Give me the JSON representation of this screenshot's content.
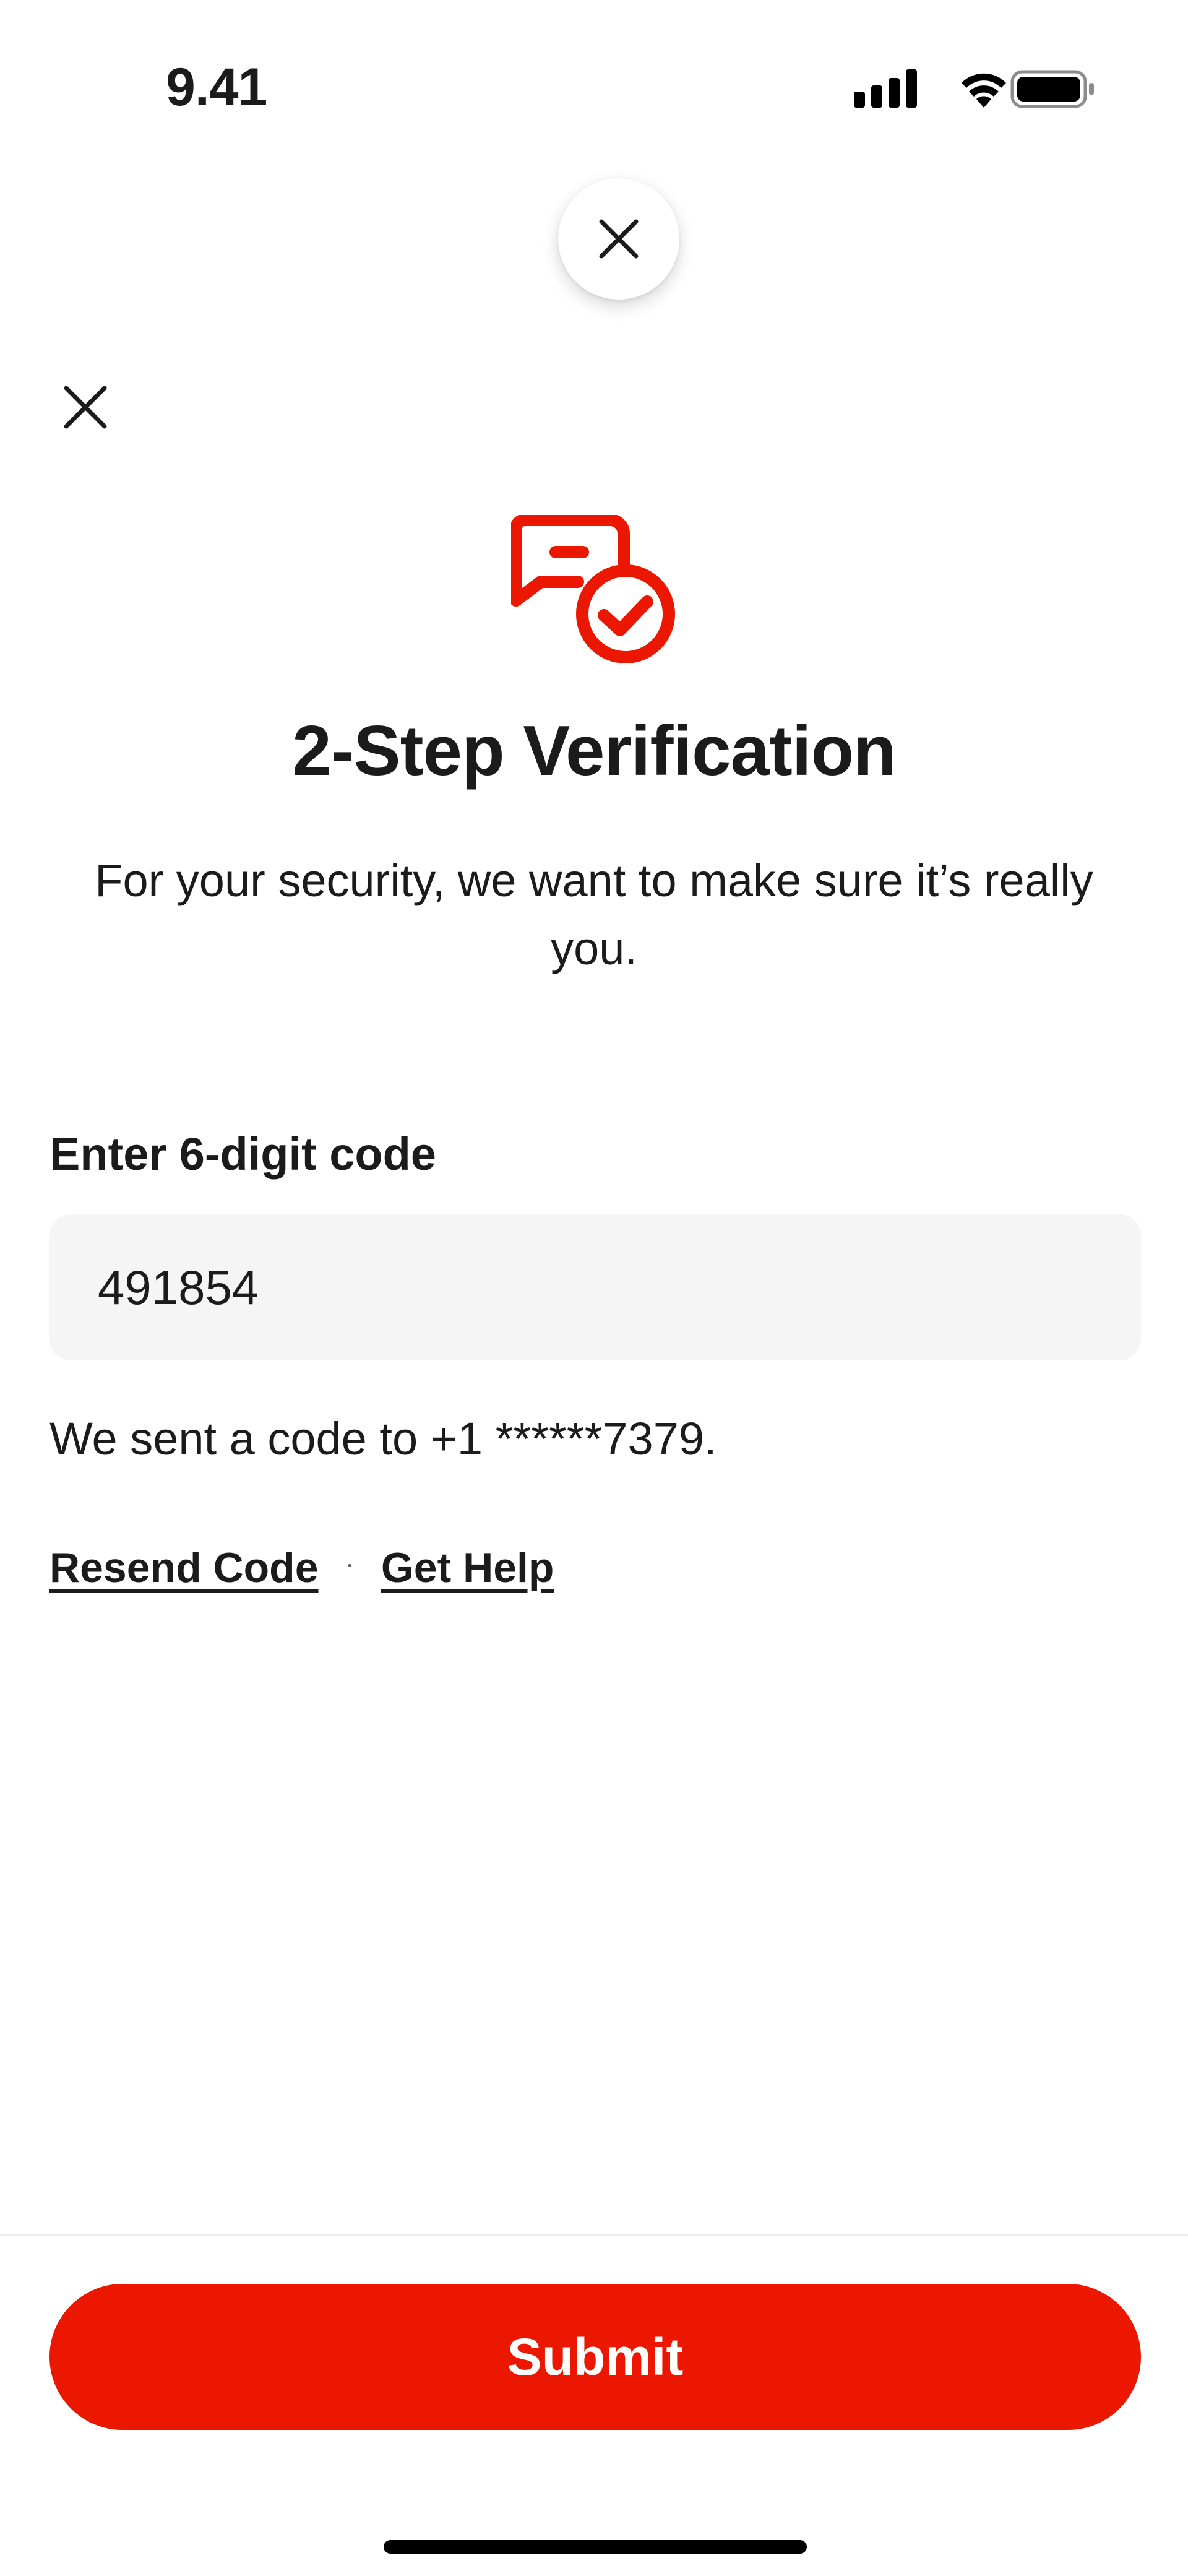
{
  "status_bar": {
    "time": "9.41",
    "icons": [
      "signal-icon",
      "wifi-icon",
      "battery-icon"
    ]
  },
  "header": {
    "sheet_close_icon": "close-icon",
    "page_close_icon": "close-icon"
  },
  "hero": {
    "icon": "chat-check-icon",
    "title": "2-Step Verification",
    "subtitle": "For your security, we want to make sure it’s really you."
  },
  "form": {
    "label": "Enter 6-digit code",
    "code_value": "491854",
    "sent_message": "We sent a code to +1 ******7379."
  },
  "links": {
    "resend": "Resend Code",
    "separator": "·",
    "help": "Get Help"
  },
  "footer": {
    "submit_label": "Submit"
  },
  "colors": {
    "brand": "#eb1700",
    "text": "#1b1b1b",
    "input_bg": "#f5f5f5"
  }
}
